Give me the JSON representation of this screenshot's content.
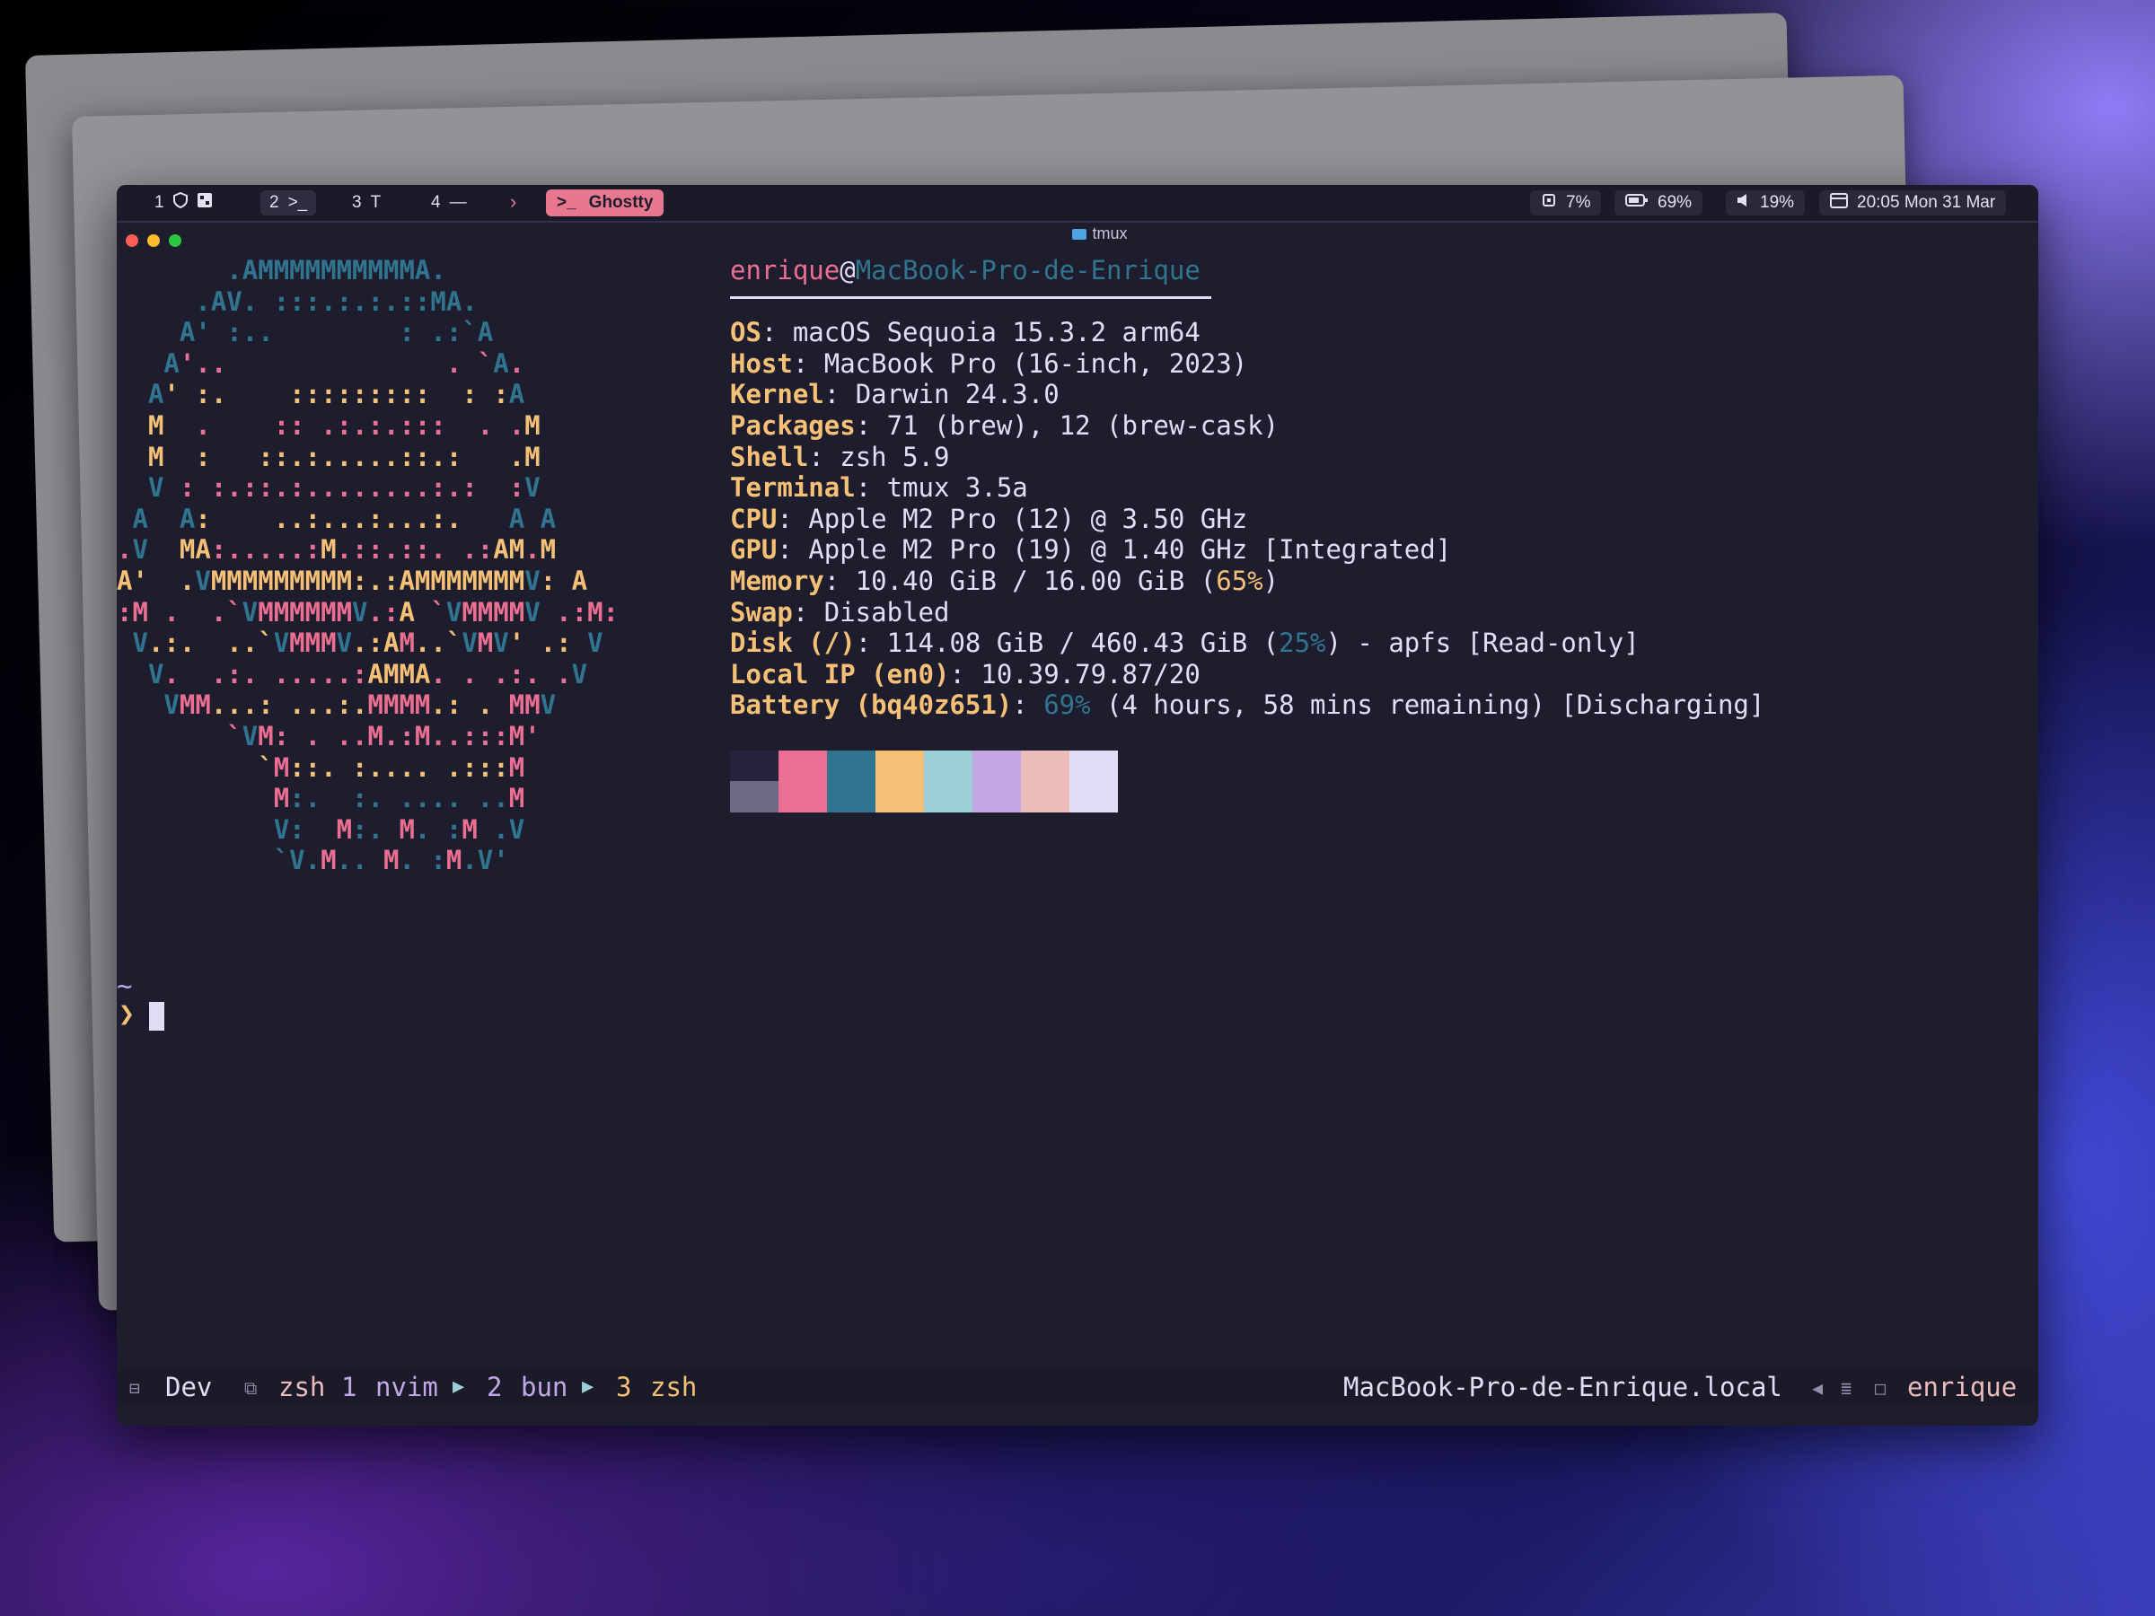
{
  "menubar": {
    "workspaces": [
      {
        "num": "1",
        "icons": [
          "shield-icon",
          "app-icon"
        ]
      },
      {
        "num": "2",
        "icon_text": ">_"
      },
      {
        "num": "3",
        "icon_text": "T"
      },
      {
        "num": "4",
        "icon_text": "—"
      }
    ],
    "active_app": {
      "icon_text": ">_",
      "label": "Ghostty"
    },
    "status": {
      "cpu": "7%",
      "battery": "69%",
      "volume": "19%",
      "datetime": "20:05 Mon 31 Mar"
    }
  },
  "window": {
    "title": "tmux"
  },
  "logo_lines": [
    "       .AMMMMMMMMMMA.          ",
    "     .AV. :::.:.:.::MA.        ",
    "    A' :..        : .:`A       ",
    "   A'..              . `A.     ",
    "  A' :.    :::::::::  : :A     ",
    "  M  .    :: .:.:.:::  . .M    ",
    "  M  :   ::.:.....::.:   .M    ",
    "  V : :.::.:........:.:  :V    ",
    " A  A:    ..:...:...:.   A A   ",
    ".V  MA:.....:M.::.::. .:AM.M   ",
    "A'  .VMMMMMMMMM:.:AMMMMMMMV: A ",
    ":M .  .`VMMMMMMV.:A `VMMMMV .:M:",
    " V.:.  ..`VMMMV.:AM..`VMV' .: V",
    "  V.  .:. .....:AMMA. . .:. .V ",
    "   VMM...: ...:.MMMM.: . MMV   ",
    "       `VM: . ..M.:M..:::M'    ",
    "         `M::. :.... .:::M     ",
    "          M:.  :. .... ..M     ",
    "          V:  M:. M. :M .V     ",
    "          `V.M.. M. :M.V'      "
  ],
  "neofetch": {
    "user": "enrique",
    "host": "MacBook-Pro-de-Enrique",
    "os": "macOS Sequoia 15.3.2 arm64",
    "host_model": "MacBook Pro (16-inch, 2023)",
    "kernel": "Darwin 24.3.0",
    "packages": "71 (brew), 12 (brew-cask)",
    "shell": "zsh 5.9",
    "terminal": "tmux 3.5a",
    "cpu": "Apple M2 Pro (12) @ 3.50 GHz",
    "gpu": "Apple M2 Pro (19) @ 1.40 GHz [Integrated]",
    "memory": "10.40 GiB / 16.00 GiB",
    "memory_pct": "65%",
    "swap": "Disabled",
    "disk_label": "Disk (/)",
    "disk": "114.08 GiB / 460.43 GiB",
    "disk_pct": "25%",
    "disk_tail": " - apfs [Read-only]",
    "local_ip_label": "Local IP (en0)",
    "local_ip": "10.39.79.87/20",
    "battery_label": "Battery (bq40z651)",
    "battery_pct": "69%",
    "battery_tail": " (4 hours, 58 mins remaining) [Discharging]"
  },
  "palette": {
    "top": [
      "#26233a",
      "#eb6f92",
      "#31748f",
      "#f6c177",
      "#9ccfd8",
      "#c4a7e7",
      "#ebbcba",
      "#e0def4"
    ],
    "bottom": [
      "#6e6a86",
      "#eb6f92",
      "#31748f",
      "#f6c177",
      "#9ccfd8",
      "#c4a7e7",
      "#ebbcba",
      "#e0def4"
    ]
  },
  "prompt": {
    "dir": "~",
    "arrow": "❯"
  },
  "statusbar": {
    "session": "Dev",
    "windows": [
      {
        "index": "",
        "name": "zsh"
      },
      {
        "index": "1",
        "name": "nvim"
      },
      {
        "index": "2",
        "name": "bun"
      },
      {
        "index": "3",
        "name": "zsh"
      }
    ],
    "hostname": "MacBook-Pro-de-Enrique.local",
    "user": "enrique"
  }
}
